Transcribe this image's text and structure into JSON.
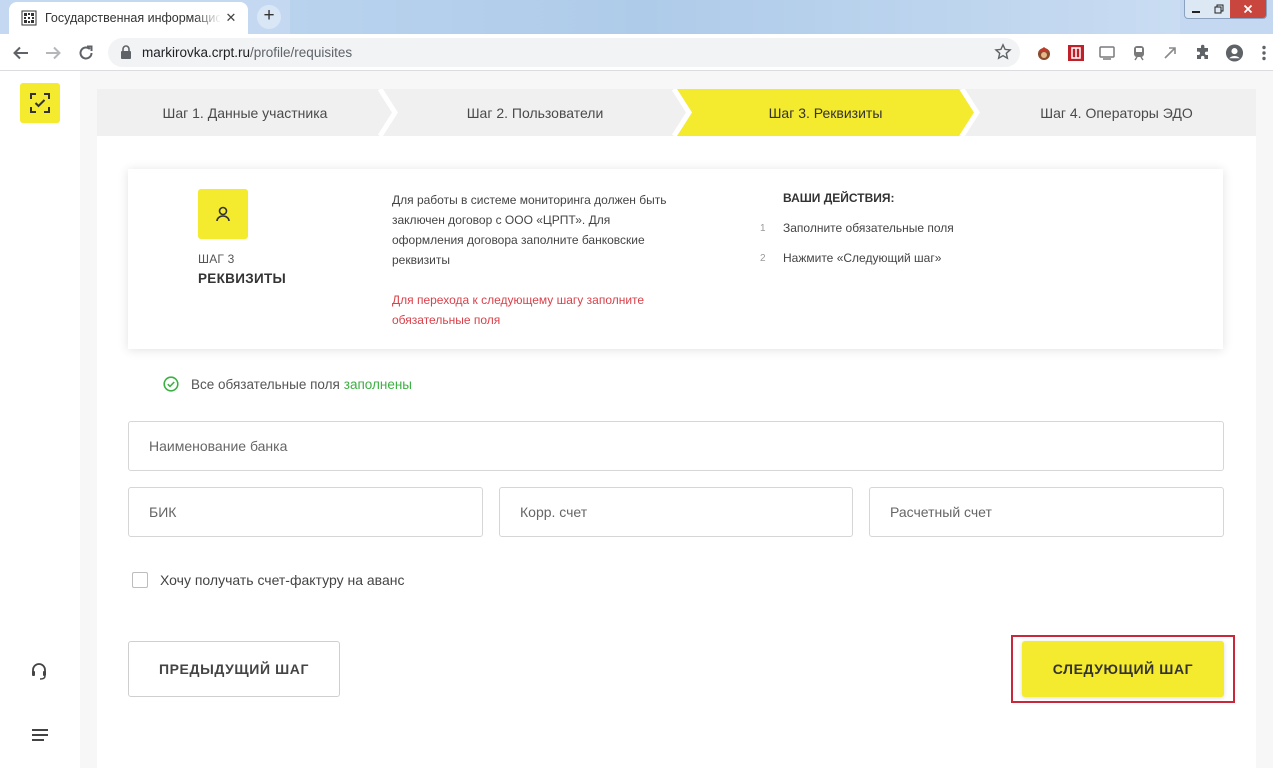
{
  "browser": {
    "tab_title": "Государственная информационная система",
    "url_host": "markirovka.crpt.ru",
    "url_path": "/profile/requisites"
  },
  "stepper": {
    "steps": [
      {
        "label": "Шаг 1. Данные участника",
        "active": false
      },
      {
        "label": "Шаг 2. Пользователи",
        "active": false
      },
      {
        "label": "Шаг 3. Реквизиты",
        "active": true
      },
      {
        "label": "Шаг 4. Операторы ЭДО",
        "active": false
      }
    ]
  },
  "info_card": {
    "step_number": "ШАГ 3",
    "step_name": "РЕКВИЗИТЫ",
    "description": "Для работы в системе мониторинга должен быть заключен договор с ООО «ЦРПТ». Для оформления договора заполните банковские реквизиты",
    "warning": "Для перехода к следующему шагу заполните обязательные поля",
    "actions_title": "ВАШИ ДЕЙСТВИЯ:",
    "actions": [
      {
        "num": "1",
        "text": "Заполните обязательные поля"
      },
      {
        "num": "2",
        "text": "Нажмите «Следующий шаг»"
      }
    ]
  },
  "status": {
    "text": "Все обязательные поля",
    "highlight": "заполнены"
  },
  "form": {
    "bank_name": {
      "placeholder": "Наименование банка",
      "value": ""
    },
    "bik": {
      "placeholder": "БИК",
      "value": ""
    },
    "corr_account": {
      "placeholder": "Корр. счет",
      "value": ""
    },
    "settlement_account": {
      "placeholder": "Расчетный счет",
      "value": ""
    },
    "advance_invoice_label": "Хочу получать счет-фактуру на аванс"
  },
  "buttons": {
    "prev": "ПРЕДЫДУЩИЙ ШАГ",
    "next": "СЛЕДУЮЩИЙ ШАГ"
  },
  "colors": {
    "accent": "#f4ea2e",
    "warning": "#d9414a",
    "success": "#3cb043",
    "highlight_frame": "#c8283a"
  }
}
